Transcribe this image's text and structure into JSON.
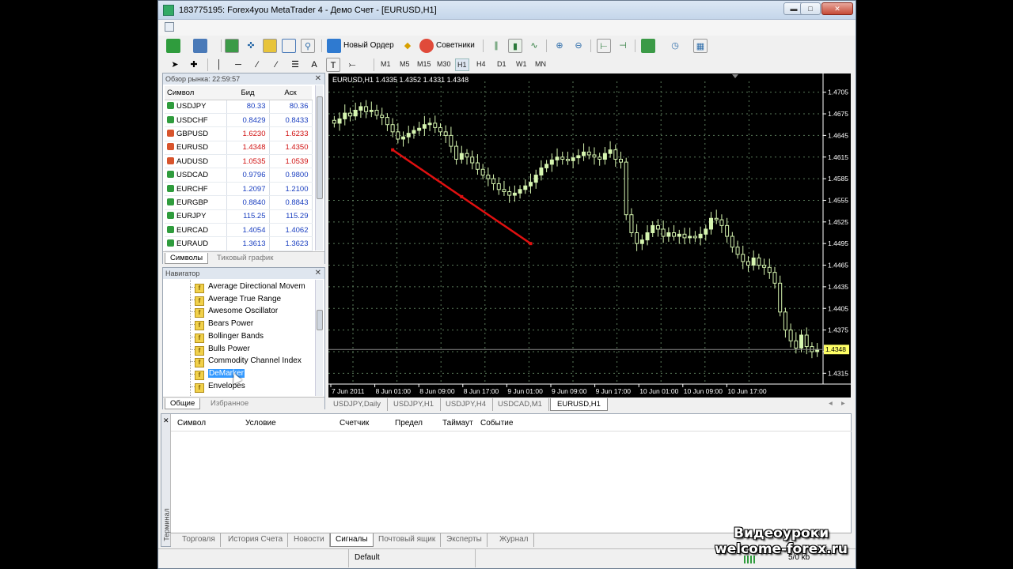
{
  "window": {
    "title": "183775195: Forex4you MetaTrader 4 - Демо Счет - [EURUSD,H1]",
    "colors": {
      "up": "#2f9c3d",
      "down": "#d8542c",
      "bid_up": "#1a3fc0",
      "bid_down": "#d01010",
      "chart_bg": "#000000",
      "candle": "#d6f5b0",
      "trendline": "#e01010",
      "grid": "#5a7a5a",
      "price_axis": "#ffffff",
      "current_price_bg": "#ffff66"
    }
  },
  "toolbar": {
    "new_order": "Новый Ордер",
    "experts": "Советники",
    "timeframes": [
      "M1",
      "M5",
      "M15",
      "M30",
      "H1",
      "H4",
      "D1",
      "W1",
      "MN"
    ],
    "active_timeframe": "H1"
  },
  "market_watch": {
    "title": "Обзор рынка: 22:59:57",
    "columns": {
      "symbol": "Символ",
      "bid": "Бид",
      "ask": "Аск"
    },
    "rows": [
      {
        "symbol": "USDJPY",
        "bid": "80.33",
        "ask": "80.36",
        "dir": "up"
      },
      {
        "symbol": "USDCHF",
        "bid": "0.8429",
        "ask": "0.8433",
        "dir": "up"
      },
      {
        "symbol": "GBPUSD",
        "bid": "1.6230",
        "ask": "1.6233",
        "dir": "down"
      },
      {
        "symbol": "EURUSD",
        "bid": "1.4348",
        "ask": "1.4350",
        "dir": "down"
      },
      {
        "symbol": "AUDUSD",
        "bid": "1.0535",
        "ask": "1.0539",
        "dir": "down"
      },
      {
        "symbol": "USDCAD",
        "bid": "0.9796",
        "ask": "0.9800",
        "dir": "up"
      },
      {
        "symbol": "EURCHF",
        "bid": "1.2097",
        "ask": "1.2100",
        "dir": "up"
      },
      {
        "symbol": "EURGBP",
        "bid": "0.8840",
        "ask": "0.8843",
        "dir": "up"
      },
      {
        "symbol": "EURJPY",
        "bid": "115.25",
        "ask": "115.29",
        "dir": "up"
      },
      {
        "symbol": "EURCAD",
        "bid": "1.4054",
        "ask": "1.4062",
        "dir": "up"
      },
      {
        "symbol": "EURAUD",
        "bid": "1.3613",
        "ask": "1.3623",
        "dir": "up"
      }
    ],
    "tabs": [
      "Символы",
      "Тиковый график"
    ]
  },
  "navigator": {
    "title": "Навигатор",
    "items": [
      "Average Directional Movem",
      "Average True Range",
      "Awesome Oscillator",
      "Bears Power",
      "Bollinger Bands",
      "Bulls Power",
      "Commodity Channel Index",
      "DeMarker",
      "Envelopes"
    ],
    "selected": "DeMarker",
    "tabs": [
      "Общие",
      "Избранное"
    ]
  },
  "chart": {
    "header": "EURUSD,H1  1.4335 1.4352 1.4331 1.4348",
    "current_price": "1.4348",
    "price_labels": [
      "1.4705",
      "1.4675",
      "1.4645",
      "1.4615",
      "1.4585",
      "1.4555",
      "1.4525",
      "1.4495",
      "1.4465",
      "1.4435",
      "1.4405",
      "1.4375",
      "1.4345",
      "1.4315"
    ],
    "time_labels": [
      "7 Jun 2011",
      "8 Jun 01:00",
      "8 Jun 09:00",
      "8 Jun 17:00",
      "9 Jun 01:00",
      "9 Jun 09:00",
      "9 Jun 17:00",
      "10 Jun 01:00",
      "10 Jun 09:00",
      "10 Jun 17:00"
    ],
    "tabs": [
      "USDJPY,Daily",
      "USDJPY,H1",
      "USDJPY,H4",
      "USDCAD,M1",
      "EURUSD,H1"
    ],
    "active_tab": "EURUSD,H1"
  },
  "chart_data": {
    "type": "candlestick",
    "title": "EURUSD,H1",
    "ylim": [
      1.43,
      1.472
    ],
    "xlabel": "",
    "ylabel": "",
    "grid": true,
    "series": [
      {
        "close": [
          1.4662,
          1.4668,
          1.4676,
          1.4672,
          1.468,
          1.4685,
          1.4678,
          1.468,
          1.4673,
          1.467,
          1.466,
          1.465,
          1.464,
          1.4643,
          1.4648,
          1.4652,
          1.4655,
          1.466,
          1.4662,
          1.4656,
          1.465,
          1.4645,
          1.463,
          1.4612,
          1.462,
          1.4615,
          1.4607,
          1.4598,
          1.459,
          1.4585,
          1.4578,
          1.457,
          1.4567,
          1.4562,
          1.4565,
          1.457,
          1.4575,
          1.458,
          1.459,
          1.46,
          1.4605,
          1.4611,
          1.4615,
          1.4612,
          1.461,
          1.4614,
          1.4617,
          1.4622,
          1.4618,
          1.4615,
          1.4612,
          1.462,
          1.4625,
          1.4612,
          1.4608,
          1.4535,
          1.451,
          1.4495,
          1.45,
          1.451,
          1.452,
          1.4515,
          1.4505,
          1.451,
          1.4505,
          1.4508,
          1.4503,
          1.4505,
          1.4503,
          1.4508,
          1.4515,
          1.453,
          1.4528,
          1.452,
          1.4505,
          1.449,
          1.448,
          1.447,
          1.4465,
          1.4475,
          1.4465,
          1.4462,
          1.4455,
          1.444,
          1.44,
          1.4375,
          1.436,
          1.435,
          1.4368,
          1.4352,
          1.4345,
          1.4348
        ]
      }
    ],
    "annotations": [
      {
        "type": "trendline",
        "from": [
          "8 Jun 04:00",
          1.4625
        ],
        "to": [
          "9 Jun 06:00",
          1.4495
        ]
      }
    ]
  },
  "terminal": {
    "side_label": "Терминал",
    "columns": [
      "Символ",
      "Условие",
      "Счетчик",
      "Предел",
      "Таймаут",
      "Событие"
    ],
    "tabs": [
      "Торговля",
      "История Счета",
      "Новости",
      "Сигналы",
      "Почтовый ящик",
      "Эксперты",
      "Журнал"
    ],
    "active_tab": "Сигналы"
  },
  "status": {
    "profile": "Default",
    "traffic": "5/0 kb"
  },
  "watermark": {
    "line1": "Видеоуроки",
    "line2": "welcome-forex.ru"
  }
}
